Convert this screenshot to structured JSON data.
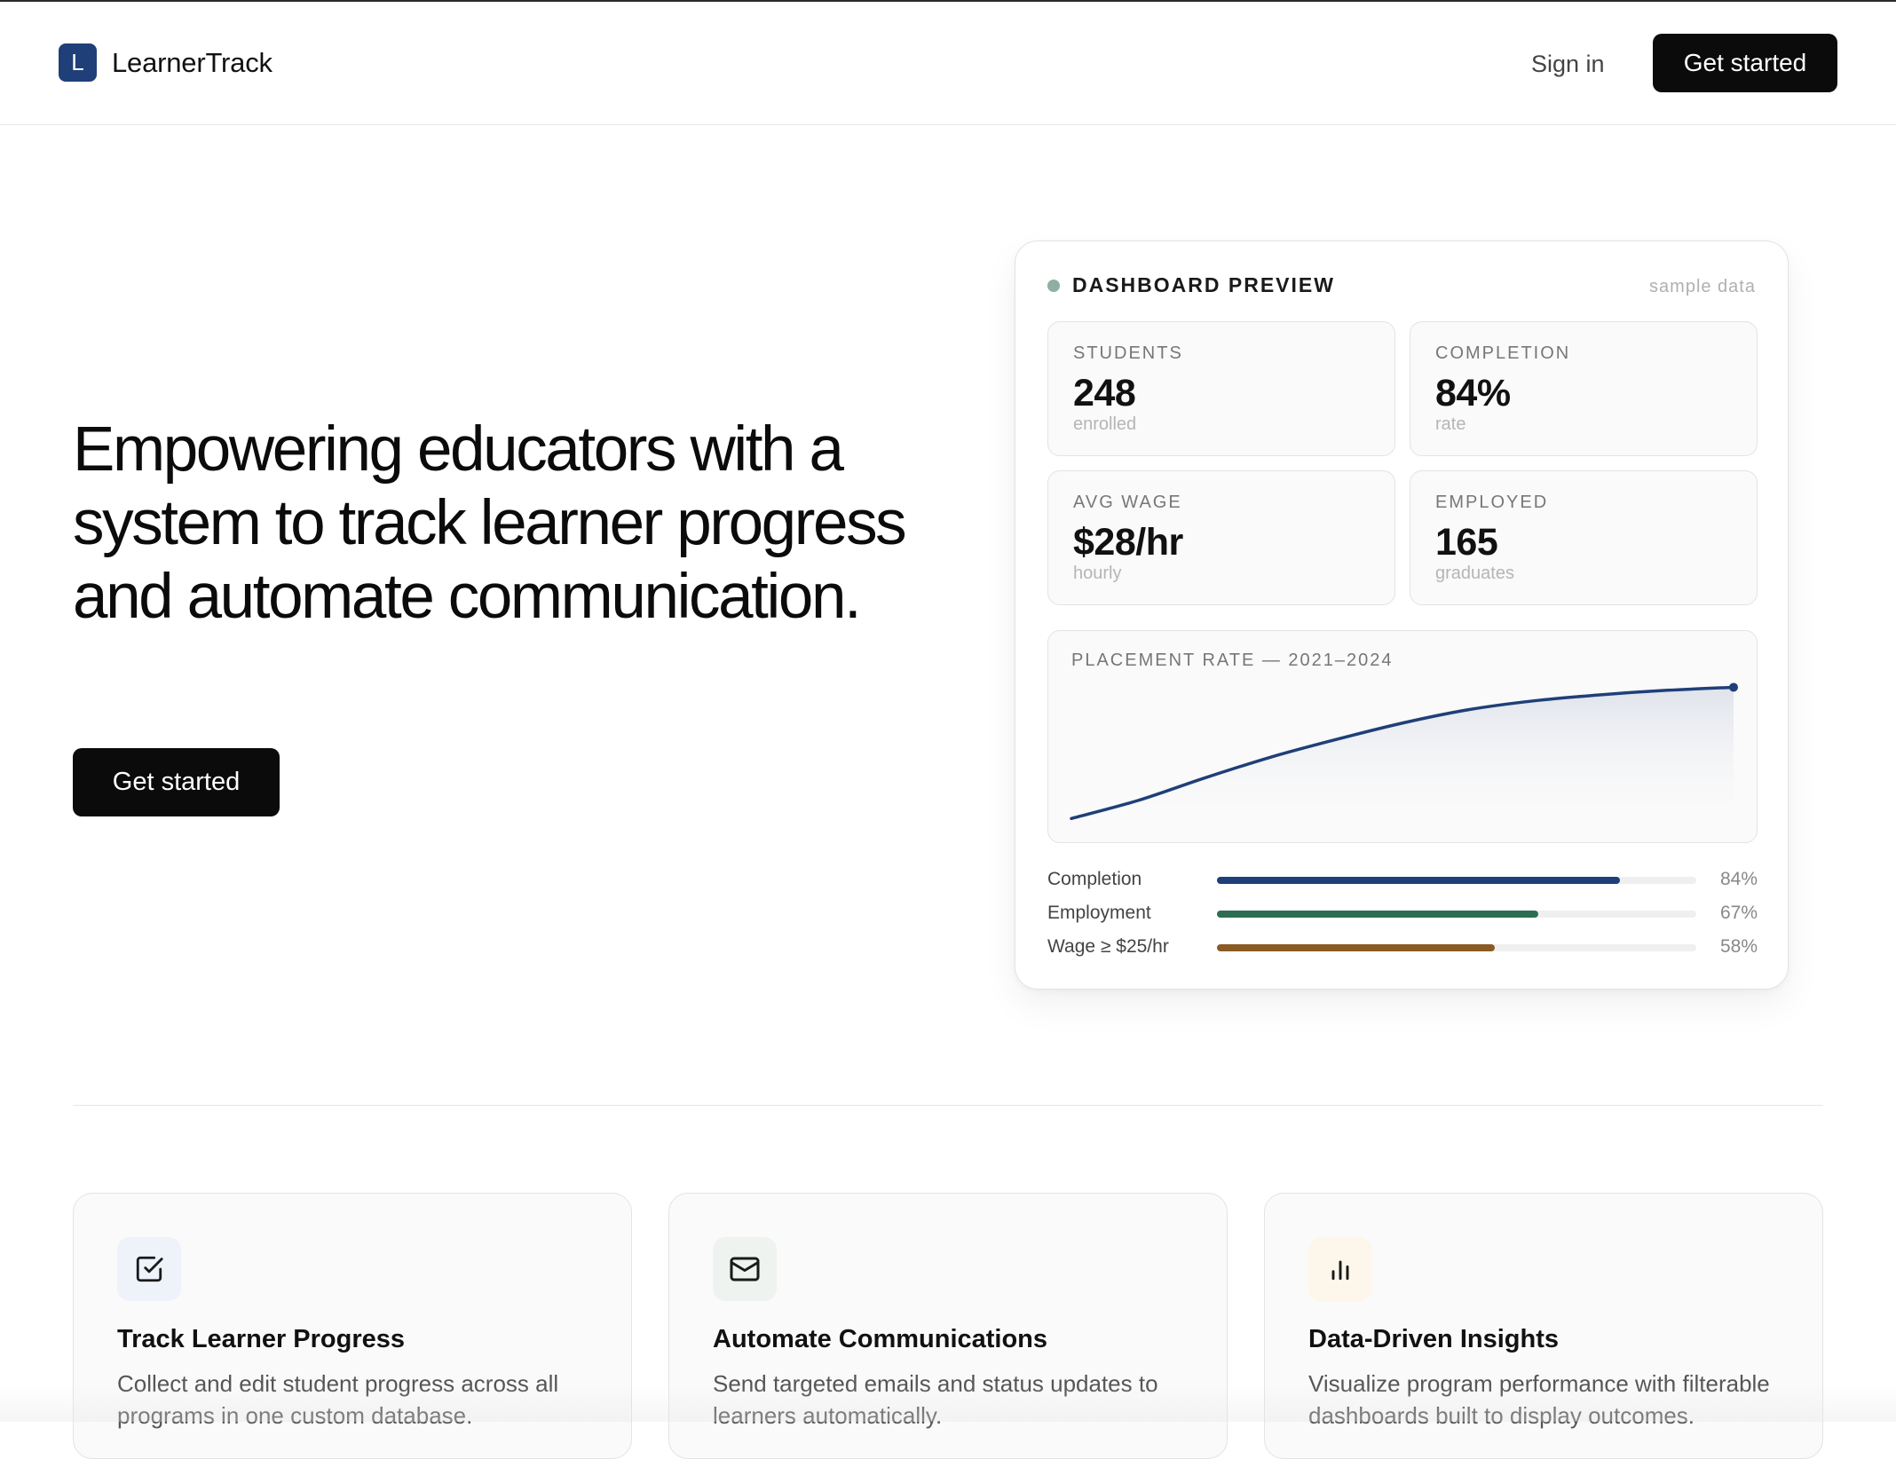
{
  "header": {
    "brand_initial": "L",
    "brand_name": "LearnerTrack",
    "signin_label": "Sign in",
    "cta_label": "Get started"
  },
  "hero": {
    "title": "Empowering educators with a system to track learner progress and automate communication.",
    "cta_label": "Get started"
  },
  "dashboard": {
    "title": "DASHBOARD PREVIEW",
    "badge": "sample data",
    "stats": [
      {
        "label": "STUDENTS",
        "value": "248",
        "sub": "enrolled"
      },
      {
        "label": "COMPLETION",
        "value": "84%",
        "sub": "rate"
      },
      {
        "label": "AVG WAGE",
        "value": "$28/hr",
        "sub": "hourly"
      },
      {
        "label": "EMPLOYED",
        "value": "165",
        "sub": "graduates"
      }
    ],
    "bars": [
      {
        "label": "Completion",
        "pct_label": "84%",
        "value": 0.84,
        "color": "#1f3f78"
      },
      {
        "label": "Employment",
        "pct_label": "67%",
        "value": 0.67,
        "color": "#2d6e52"
      },
      {
        "label": "Wage ≥ $25/hr",
        "pct_label": "58%",
        "value": 0.58,
        "color": "#8a5a24"
      }
    ]
  },
  "chart_data": {
    "type": "area",
    "title": "PLACEMENT RATE — 2021–2024",
    "x": [
      0,
      0.1,
      0.2,
      0.3,
      0.4,
      0.5,
      0.6,
      0.7,
      0.8,
      0.9,
      1.0
    ],
    "values": [
      0.04,
      0.16,
      0.31,
      0.45,
      0.57,
      0.68,
      0.77,
      0.83,
      0.87,
      0.9,
      0.92
    ],
    "ylim": [
      0,
      1
    ],
    "grid": false,
    "color": "#1f3f78"
  },
  "features": [
    {
      "title": "Track Learner Progress",
      "desc": "Collect and edit student progress across all programs in one custom database.",
      "icon": "checkbox-icon",
      "icon_bg": "#eef2f9"
    },
    {
      "title": "Automate Communications",
      "desc": "Send targeted emails and status updates to learners automatically.",
      "icon": "mail-icon",
      "icon_bg": "#eef3f0"
    },
    {
      "title": "Data-Driven Insights",
      "desc": "Visualize program performance with filterable dashboards built to display outcomes.",
      "icon": "bar-chart-icon",
      "icon_bg": "#fcf7ea"
    }
  ]
}
